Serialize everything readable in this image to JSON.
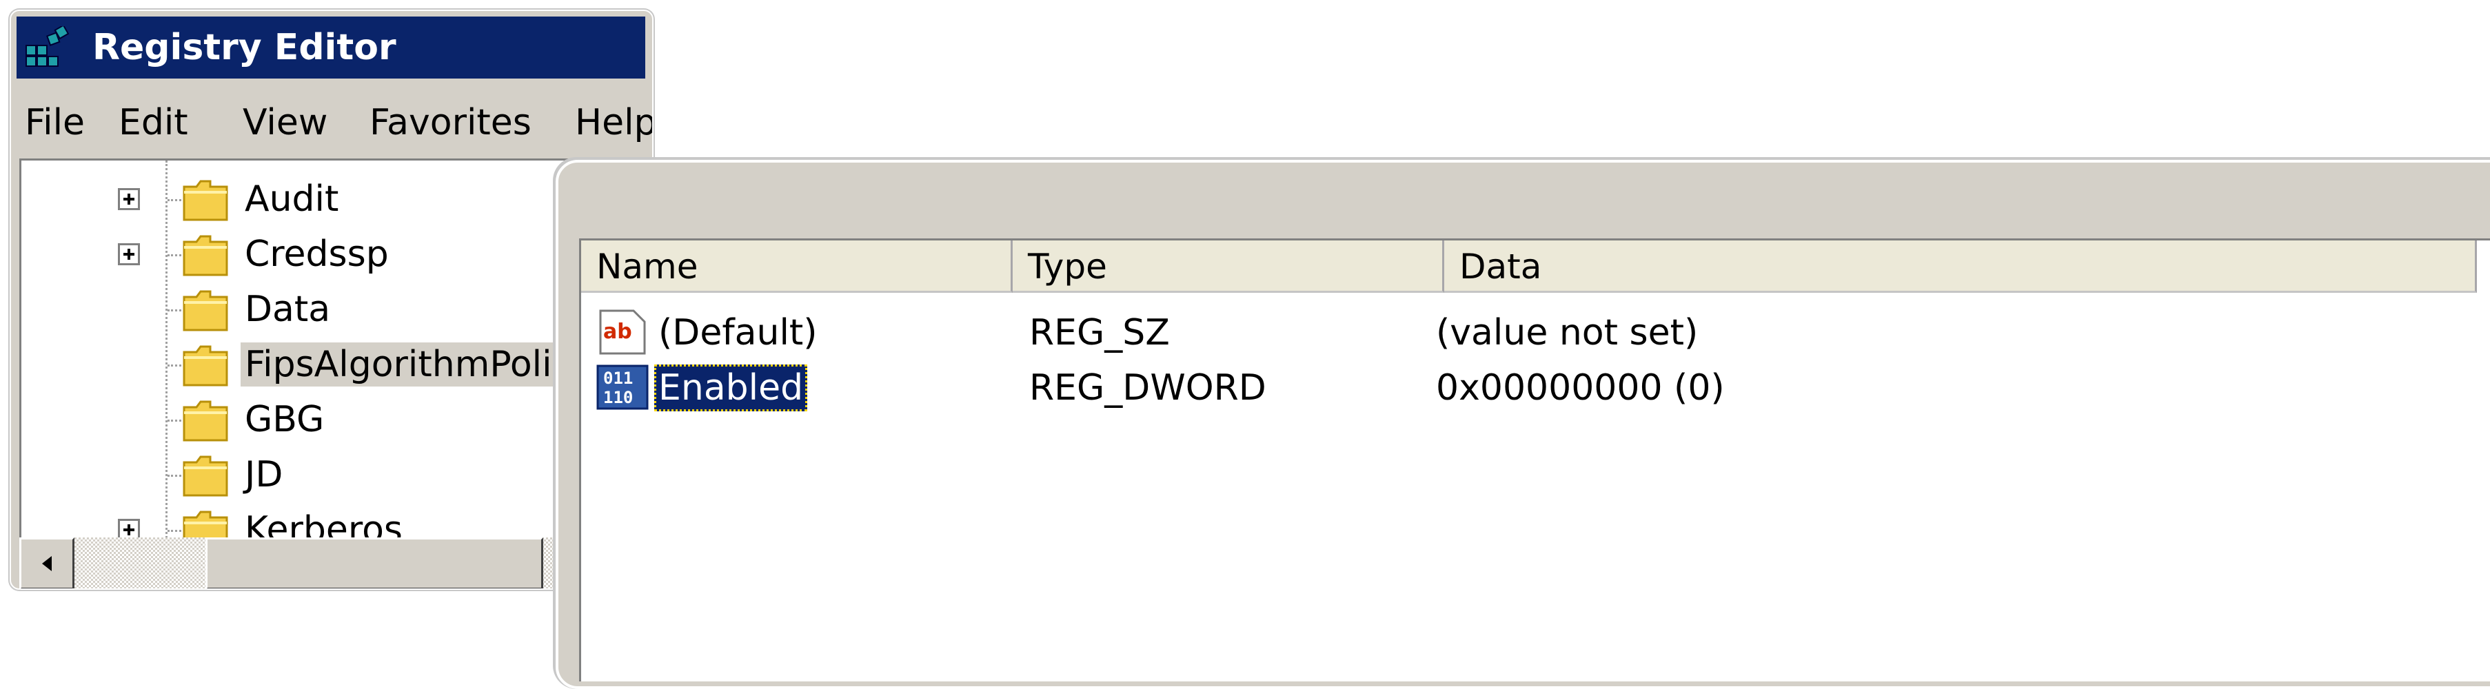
{
  "window": {
    "title": "Registry Editor",
    "app_icon": "registry-editor-icon"
  },
  "menu": [
    "File",
    "Edit",
    "View",
    "Favorites",
    "Help"
  ],
  "tree": {
    "nodes": [
      {
        "label": "Audit",
        "expandable": true
      },
      {
        "label": "Credssp",
        "expandable": true
      },
      {
        "label": "Data",
        "expandable": false
      },
      {
        "label": "FipsAlgorithmPolicy",
        "expandable": false,
        "selected": true
      },
      {
        "label": "GBG",
        "expandable": false
      },
      {
        "label": "JD",
        "expandable": false
      },
      {
        "label": "Kerberos",
        "expandable": true
      }
    ]
  },
  "values": {
    "columns": [
      "Name",
      "Type",
      "Data"
    ],
    "rows": [
      {
        "icon": "string-value-icon",
        "name": "(Default)",
        "type": "REG_SZ",
        "data": "(value not set)"
      },
      {
        "icon": "dword-value-icon",
        "name": "Enabled",
        "type": "REG_DWORD",
        "data": "0x00000000 (0)",
        "selected": true
      }
    ]
  },
  "colors": {
    "titlebar": "#0a246a",
    "window_face": "#d4d0c8",
    "selection": "#0a246a",
    "folder": "#f5cf4a"
  }
}
